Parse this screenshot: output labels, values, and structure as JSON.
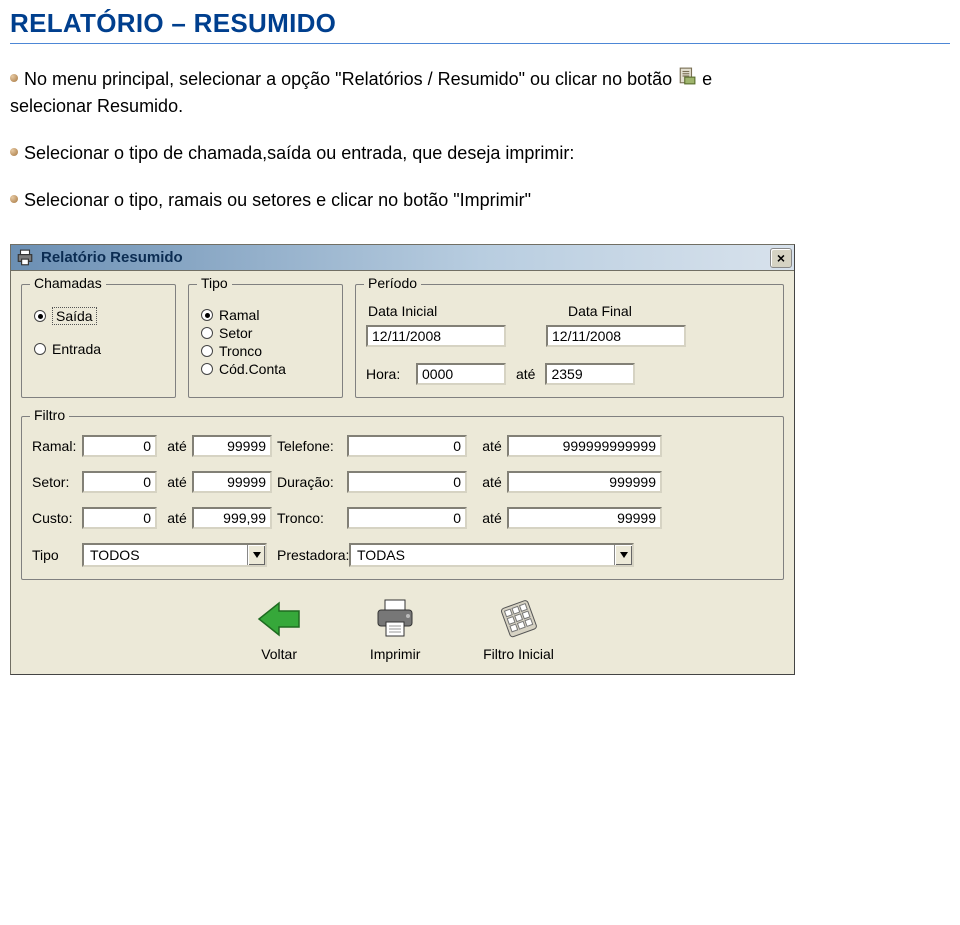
{
  "page": {
    "title": "RELATÓRIO – RESUMIDO",
    "instruction1_a": "No menu principal, selecionar a opção \"Relatórios / Resumido\" ou clicar no botão",
    "instruction1_b": " e",
    "instruction1_cont": "selecionar Resumido.",
    "instruction2": "Selecionar o tipo de chamada,saída ou entrada, que deseja imprimir:",
    "instruction3": "Selecionar o tipo, ramais ou setores e clicar no botão \"Imprimir\""
  },
  "dialog": {
    "title": "Relatório Resumido",
    "close_glyph": "×",
    "groups": {
      "chamadas": {
        "legend": "Chamadas",
        "options": [
          "Saída",
          "Entrada"
        ],
        "selected": "Saída"
      },
      "tipo": {
        "legend": "Tipo",
        "options": [
          "Ramal",
          "Setor",
          "Tronco",
          "Cód.Conta"
        ],
        "selected": "Ramal"
      },
      "periodo": {
        "legend": "Período",
        "labels": {
          "data_inicial": "Data Inicial",
          "data_final": "Data Final",
          "hora": "Hora:",
          "ate": "até"
        },
        "values": {
          "data_inicial": "12/11/2008",
          "data_final": "12/11/2008",
          "hora_ini": "0000",
          "hora_fim": "2359"
        }
      }
    },
    "filtro": {
      "legend": "Filtro",
      "labels": {
        "ramal": "Ramal:",
        "setor": "Setor:",
        "custo": "Custo:",
        "tipo": "Tipo",
        "telefone": "Telefone:",
        "duracao": "Duração:",
        "tronco": "Tronco:",
        "prestadora": "Prestadora:",
        "ate": "até"
      },
      "values": {
        "ramal_de": "0",
        "ramal_ate": "99999",
        "setor_de": "0",
        "setor_ate": "99999",
        "custo_de": "0",
        "custo_ate": "999,99",
        "telefone_de": "0",
        "telefone_ate": "999999999999",
        "duracao_de": "0",
        "duracao_ate": "999999",
        "tronco_de": "0",
        "tronco_ate": "99999",
        "tipo_sel": "TODOS",
        "prestadora_sel": "TODAS"
      }
    },
    "actions": {
      "voltar": "Voltar",
      "imprimir": "Imprimir",
      "filtro_inicial": "Filtro Inicial"
    }
  }
}
